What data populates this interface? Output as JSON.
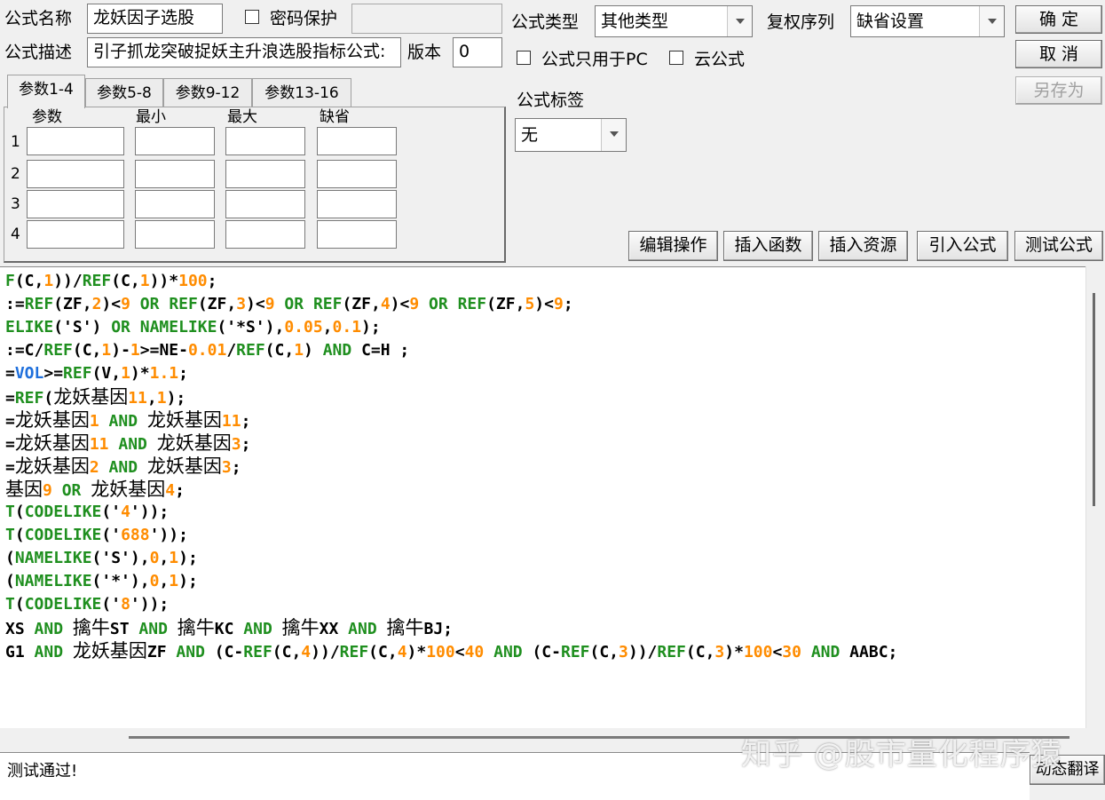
{
  "formula_name": {
    "label": "公式名称",
    "value": "龙妖因子选股"
  },
  "password": {
    "label": "密码保护",
    "value": ""
  },
  "formula_desc": {
    "label": "公式描述",
    "value": "引子抓龙突破捉妖主升浪选股指标公式:"
  },
  "version": {
    "label": "版本",
    "value": "0"
  },
  "formula_type": {
    "label": "公式类型",
    "value": "其他类型"
  },
  "rights": {
    "label": "复权序列",
    "value": "缺省设置"
  },
  "pc_only": {
    "label": "公式只用于PC"
  },
  "cloud": {
    "label": "云公式"
  },
  "tag": {
    "label": "公式标签",
    "value": "无"
  },
  "buttons": {
    "ok": "确 定",
    "cancel": "取 消",
    "save_as": "另存为"
  },
  "tabs": [
    "参数1-4",
    "参数5-8",
    "参数9-12",
    "参数13-16"
  ],
  "param_headers": [
    "参数",
    "最小",
    "最大",
    "缺省"
  ],
  "param_rows": [
    "1",
    "2",
    "3",
    "4"
  ],
  "toolbar": [
    "编辑操作",
    "插入函数",
    "插入资源",
    "引入公式",
    "测试公式"
  ],
  "code_lines": [
    "F(C,1))/REF(C,1))*100;",
    ":=REF(ZF,2)<9 OR REF(ZF,3)<9 OR REF(ZF,4)<9 OR REF(ZF,5)<9;",
    "ELIKE('S') OR NAMELIKE('*S'),0.05,0.1);",
    ":=C/REF(C,1)-1>=NE-0.01/REF(C,1) AND C=H ;",
    "=VOL>=REF(V,1)*1.1;",
    "=REF(龙妖基因11,1);",
    "=龙妖基因1 AND 龙妖基因11;",
    "=龙妖基因11 AND 龙妖基因3;",
    "=龙妖基因2 AND 龙妖基因3;",
    "基因9 OR 龙妖基因4;",
    "T(CODELIKE('4'));",
    "T(CODELIKE('688'));",
    "(NAMELIKE('S'),0,1);",
    "(NAMELIKE('*'),0,1);",
    "T(CODELIKE('8'));",
    "XS AND 擒牛ST AND 擒牛KC AND 擒牛XX AND 擒牛BJ;",
    "G1 AND 龙妖基因ZF AND (C-REF(C,4))/REF(C,4)*100<40 AND (C-REF(C,3))/REF(C,3)*100<30 AND AABC;"
  ],
  "status": "测试通过!",
  "dynamic_translate": "动态翻译",
  "watermark": "知乎 @股市量化程序猿"
}
